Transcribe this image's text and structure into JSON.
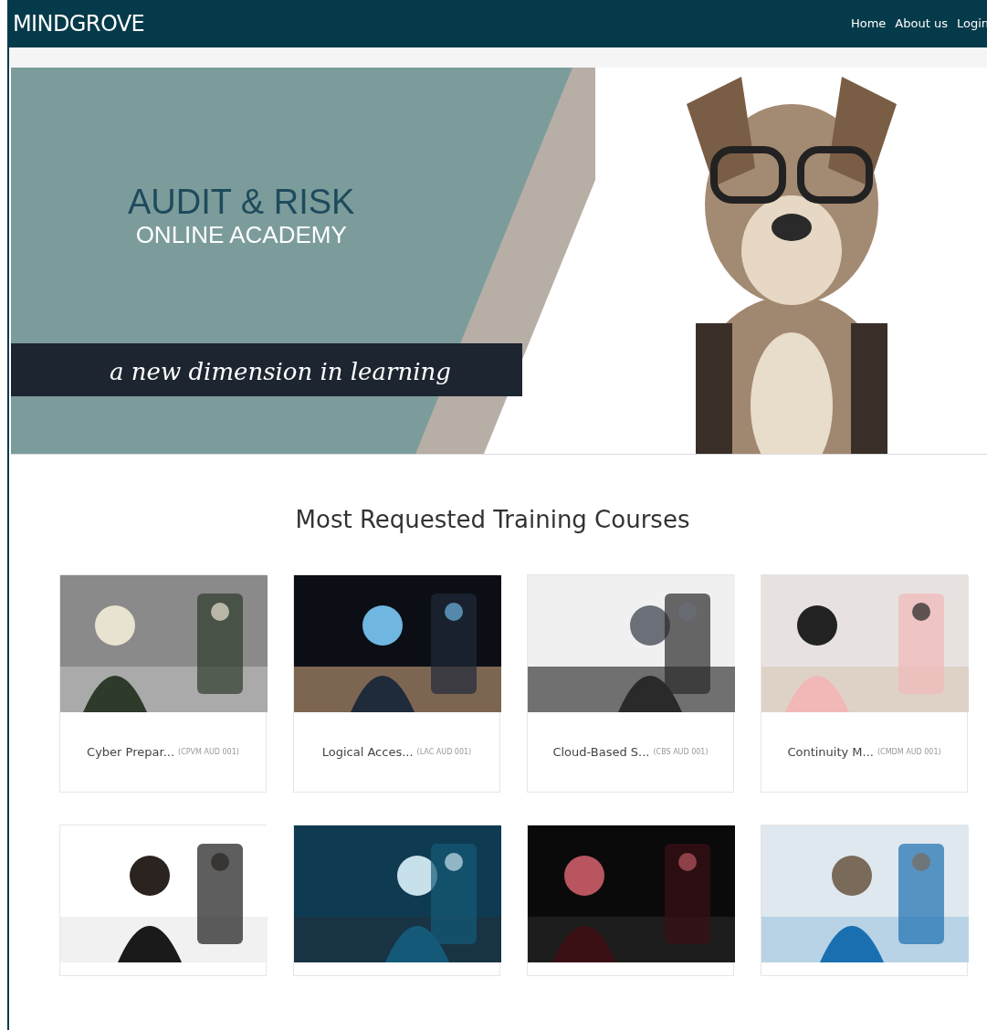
{
  "header": {
    "brand": "MINDGROVE",
    "nav": [
      {
        "label": "Home"
      },
      {
        "label": "About us"
      },
      {
        "label": "Login"
      }
    ]
  },
  "hero": {
    "title": "AUDIT & RISK",
    "subtitle": "ONLINE ACADEMY",
    "tagline": "a new dimension in learning",
    "photo": {
      "kind": "picture"
    }
  },
  "section_title": "Most Requested Training Courses",
  "courses": [
    {
      "kind": "picture",
      "title": "Cyber Prepar...",
      "code": "(CPVM AUD 001)"
    },
    {
      "kind": "picture",
      "title": "Logical Acces...",
      "code": "(LAC AUD 001)"
    },
    {
      "kind": "picture",
      "title": "Cloud-Based S...",
      "code": "(CBS AUD 001)"
    },
    {
      "kind": "picture",
      "title": "Continuity M...",
      "code": "(CMDM AUD 001)"
    },
    {
      "kind": "picture"
    },
    {
      "kind": "picture"
    },
    {
      "kind": "picture"
    },
    {
      "kind": "picture"
    }
  ]
}
